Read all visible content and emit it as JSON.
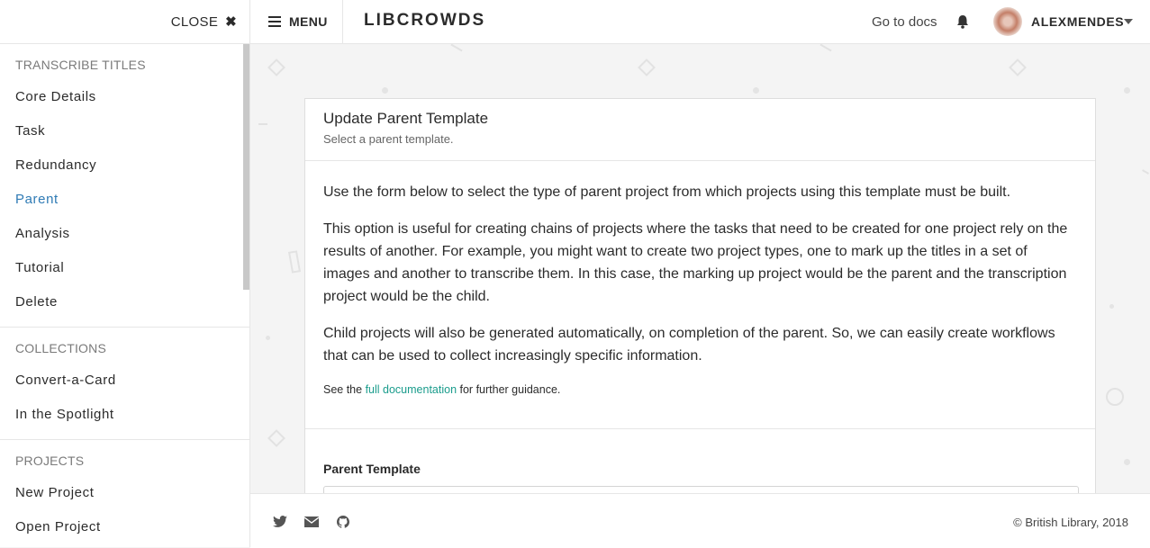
{
  "sidebar": {
    "close_label": "CLOSE",
    "sections": [
      {
        "heading": "TRANSCRIBE TITLES",
        "items": [
          "Core Details",
          "Task",
          "Redundancy",
          "Parent",
          "Analysis",
          "Tutorial",
          "Delete"
        ],
        "active": "Parent"
      },
      {
        "heading": "COLLECTIONS",
        "items": [
          "Convert-a-Card",
          "In the Spotlight"
        ]
      },
      {
        "heading": "PROJECTS",
        "items": [
          "New Project",
          "Open Project"
        ]
      }
    ]
  },
  "topbar": {
    "menu_label": "MENU",
    "brand": "LIBCROWDS",
    "docs_link": "Go to docs",
    "username": "ALEXMENDES"
  },
  "card": {
    "title": "Update Parent Template",
    "subtitle": "Select a parent template.",
    "paragraphs": [
      "Use the form below to select the type of parent project from which projects using this template must be built.",
      "This option is useful for creating chains of projects where the tasks that need to be created for one project rely on the results of another. For example, you might want to create two project types, one to mark up the titles in a set of images and another to transcribe them. In this case, the marking up project would be the parent and the transcription project would be the child.",
      "Child projects will also be generated automatically, on completion of the parent. So, we can easily create workflows that can be used to collect increasingly specific information."
    ],
    "guidance_prefix": "See the ",
    "guidance_link": "full documentation",
    "guidance_suffix": " for further guidance.",
    "form_label": "Parent Template"
  },
  "footer": {
    "icons": [
      "twitter-icon",
      "email-icon",
      "github-icon"
    ],
    "copyright": "© British Library, 2018"
  },
  "colors": {
    "accent_link": "#1a9c8c",
    "active_nav": "#2f7bb5"
  }
}
